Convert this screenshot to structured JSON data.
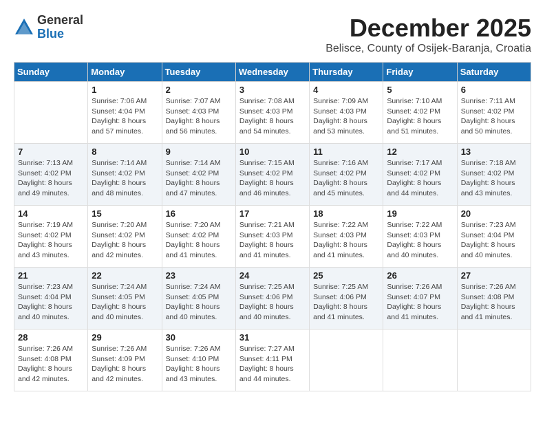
{
  "header": {
    "logo_general": "General",
    "logo_blue": "Blue",
    "month_title": "December 2025",
    "subtitle": "Belisce, County of Osijek-Baranja, Croatia"
  },
  "weekdays": [
    "Sunday",
    "Monday",
    "Tuesday",
    "Wednesday",
    "Thursday",
    "Friday",
    "Saturday"
  ],
  "weeks": [
    [
      {
        "day": "",
        "info": ""
      },
      {
        "day": "1",
        "info": "Sunrise: 7:06 AM\nSunset: 4:04 PM\nDaylight: 8 hours\nand 57 minutes."
      },
      {
        "day": "2",
        "info": "Sunrise: 7:07 AM\nSunset: 4:03 PM\nDaylight: 8 hours\nand 56 minutes."
      },
      {
        "day": "3",
        "info": "Sunrise: 7:08 AM\nSunset: 4:03 PM\nDaylight: 8 hours\nand 54 minutes."
      },
      {
        "day": "4",
        "info": "Sunrise: 7:09 AM\nSunset: 4:03 PM\nDaylight: 8 hours\nand 53 minutes."
      },
      {
        "day": "5",
        "info": "Sunrise: 7:10 AM\nSunset: 4:02 PM\nDaylight: 8 hours\nand 51 minutes."
      },
      {
        "day": "6",
        "info": "Sunrise: 7:11 AM\nSunset: 4:02 PM\nDaylight: 8 hours\nand 50 minutes."
      }
    ],
    [
      {
        "day": "7",
        "info": "Sunrise: 7:13 AM\nSunset: 4:02 PM\nDaylight: 8 hours\nand 49 minutes."
      },
      {
        "day": "8",
        "info": "Sunrise: 7:14 AM\nSunset: 4:02 PM\nDaylight: 8 hours\nand 48 minutes."
      },
      {
        "day": "9",
        "info": "Sunrise: 7:14 AM\nSunset: 4:02 PM\nDaylight: 8 hours\nand 47 minutes."
      },
      {
        "day": "10",
        "info": "Sunrise: 7:15 AM\nSunset: 4:02 PM\nDaylight: 8 hours\nand 46 minutes."
      },
      {
        "day": "11",
        "info": "Sunrise: 7:16 AM\nSunset: 4:02 PM\nDaylight: 8 hours\nand 45 minutes."
      },
      {
        "day": "12",
        "info": "Sunrise: 7:17 AM\nSunset: 4:02 PM\nDaylight: 8 hours\nand 44 minutes."
      },
      {
        "day": "13",
        "info": "Sunrise: 7:18 AM\nSunset: 4:02 PM\nDaylight: 8 hours\nand 43 minutes."
      }
    ],
    [
      {
        "day": "14",
        "info": "Sunrise: 7:19 AM\nSunset: 4:02 PM\nDaylight: 8 hours\nand 43 minutes."
      },
      {
        "day": "15",
        "info": "Sunrise: 7:20 AM\nSunset: 4:02 PM\nDaylight: 8 hours\nand 42 minutes."
      },
      {
        "day": "16",
        "info": "Sunrise: 7:20 AM\nSunset: 4:02 PM\nDaylight: 8 hours\nand 41 minutes."
      },
      {
        "day": "17",
        "info": "Sunrise: 7:21 AM\nSunset: 4:03 PM\nDaylight: 8 hours\nand 41 minutes."
      },
      {
        "day": "18",
        "info": "Sunrise: 7:22 AM\nSunset: 4:03 PM\nDaylight: 8 hours\nand 41 minutes."
      },
      {
        "day": "19",
        "info": "Sunrise: 7:22 AM\nSunset: 4:03 PM\nDaylight: 8 hours\nand 40 minutes."
      },
      {
        "day": "20",
        "info": "Sunrise: 7:23 AM\nSunset: 4:04 PM\nDaylight: 8 hours\nand 40 minutes."
      }
    ],
    [
      {
        "day": "21",
        "info": "Sunrise: 7:23 AM\nSunset: 4:04 PM\nDaylight: 8 hours\nand 40 minutes."
      },
      {
        "day": "22",
        "info": "Sunrise: 7:24 AM\nSunset: 4:05 PM\nDaylight: 8 hours\nand 40 minutes."
      },
      {
        "day": "23",
        "info": "Sunrise: 7:24 AM\nSunset: 4:05 PM\nDaylight: 8 hours\nand 40 minutes."
      },
      {
        "day": "24",
        "info": "Sunrise: 7:25 AM\nSunset: 4:06 PM\nDaylight: 8 hours\nand 40 minutes."
      },
      {
        "day": "25",
        "info": "Sunrise: 7:25 AM\nSunset: 4:06 PM\nDaylight: 8 hours\nand 41 minutes."
      },
      {
        "day": "26",
        "info": "Sunrise: 7:26 AM\nSunset: 4:07 PM\nDaylight: 8 hours\nand 41 minutes."
      },
      {
        "day": "27",
        "info": "Sunrise: 7:26 AM\nSunset: 4:08 PM\nDaylight: 8 hours\nand 41 minutes."
      }
    ],
    [
      {
        "day": "28",
        "info": "Sunrise: 7:26 AM\nSunset: 4:08 PM\nDaylight: 8 hours\nand 42 minutes."
      },
      {
        "day": "29",
        "info": "Sunrise: 7:26 AM\nSunset: 4:09 PM\nDaylight: 8 hours\nand 42 minutes."
      },
      {
        "day": "30",
        "info": "Sunrise: 7:26 AM\nSunset: 4:10 PM\nDaylight: 8 hours\nand 43 minutes."
      },
      {
        "day": "31",
        "info": "Sunrise: 7:27 AM\nSunset: 4:11 PM\nDaylight: 8 hours\nand 44 minutes."
      },
      {
        "day": "",
        "info": ""
      },
      {
        "day": "",
        "info": ""
      },
      {
        "day": "",
        "info": ""
      }
    ]
  ]
}
